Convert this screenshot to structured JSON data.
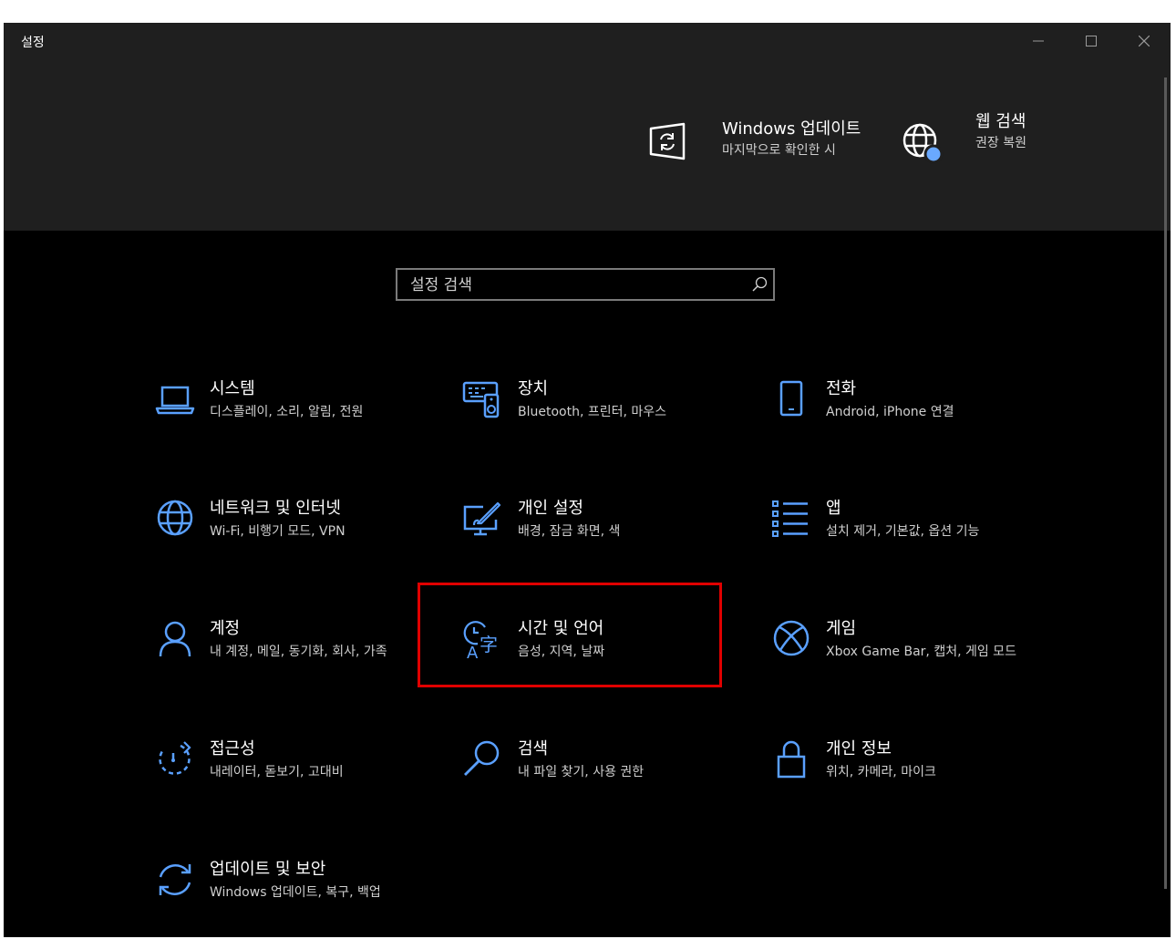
{
  "window": {
    "title": "설정"
  },
  "header": {
    "update": {
      "title": "Windows 업데이트",
      "subtitle": "마지막으로 확인한 시"
    },
    "websearch": {
      "title": "웹 검색",
      "subtitle": "권장 복원"
    }
  },
  "search": {
    "placeholder": "설정 검색"
  },
  "tiles": [
    {
      "title": "시스템",
      "subtitle": "디스플레이, 소리, 알림, 전원",
      "icon": "laptop-icon"
    },
    {
      "title": "장치",
      "subtitle": "Bluetooth, 프린터, 마우스",
      "icon": "devices-icon"
    },
    {
      "title": "전화",
      "subtitle": "Android, iPhone 연결",
      "icon": "phone-icon"
    },
    {
      "title": "네트워크 및 인터넷",
      "subtitle": "Wi-Fi, 비행기 모드, VPN",
      "icon": "globe-icon"
    },
    {
      "title": "개인 설정",
      "subtitle": "배경, 잠금 화면, 색",
      "icon": "personalization-icon"
    },
    {
      "title": "앱",
      "subtitle": "설치 제거, 기본값, 옵션 기능",
      "icon": "apps-list-icon"
    },
    {
      "title": "계정",
      "subtitle": "내 계정, 메일, 동기화, 회사, 가족",
      "icon": "person-icon"
    },
    {
      "title": "시간 및 언어",
      "subtitle": "음성, 지역, 날짜",
      "icon": "time-language-icon"
    },
    {
      "title": "게임",
      "subtitle": "Xbox Game Bar, 캡처, 게임 모드",
      "icon": "xbox-icon"
    },
    {
      "title": "접근성",
      "subtitle": "내레이터, 돋보기, 고대비",
      "icon": "accessibility-timer-icon"
    },
    {
      "title": "검색",
      "subtitle": "내 파일 찾기, 사용 권한",
      "icon": "search-icon"
    },
    {
      "title": "개인 정보",
      "subtitle": "위치, 카메라, 마이크",
      "icon": "lock-icon"
    },
    {
      "title": "업데이트 및 보안",
      "subtitle": "Windows 업데이트, 복구, 백업",
      "icon": "sync-icon"
    }
  ],
  "colors": {
    "accent": "#5aa0ff",
    "highlight": "#e00000",
    "header_bg": "#1f1f1f",
    "body_bg": "#000000"
  }
}
